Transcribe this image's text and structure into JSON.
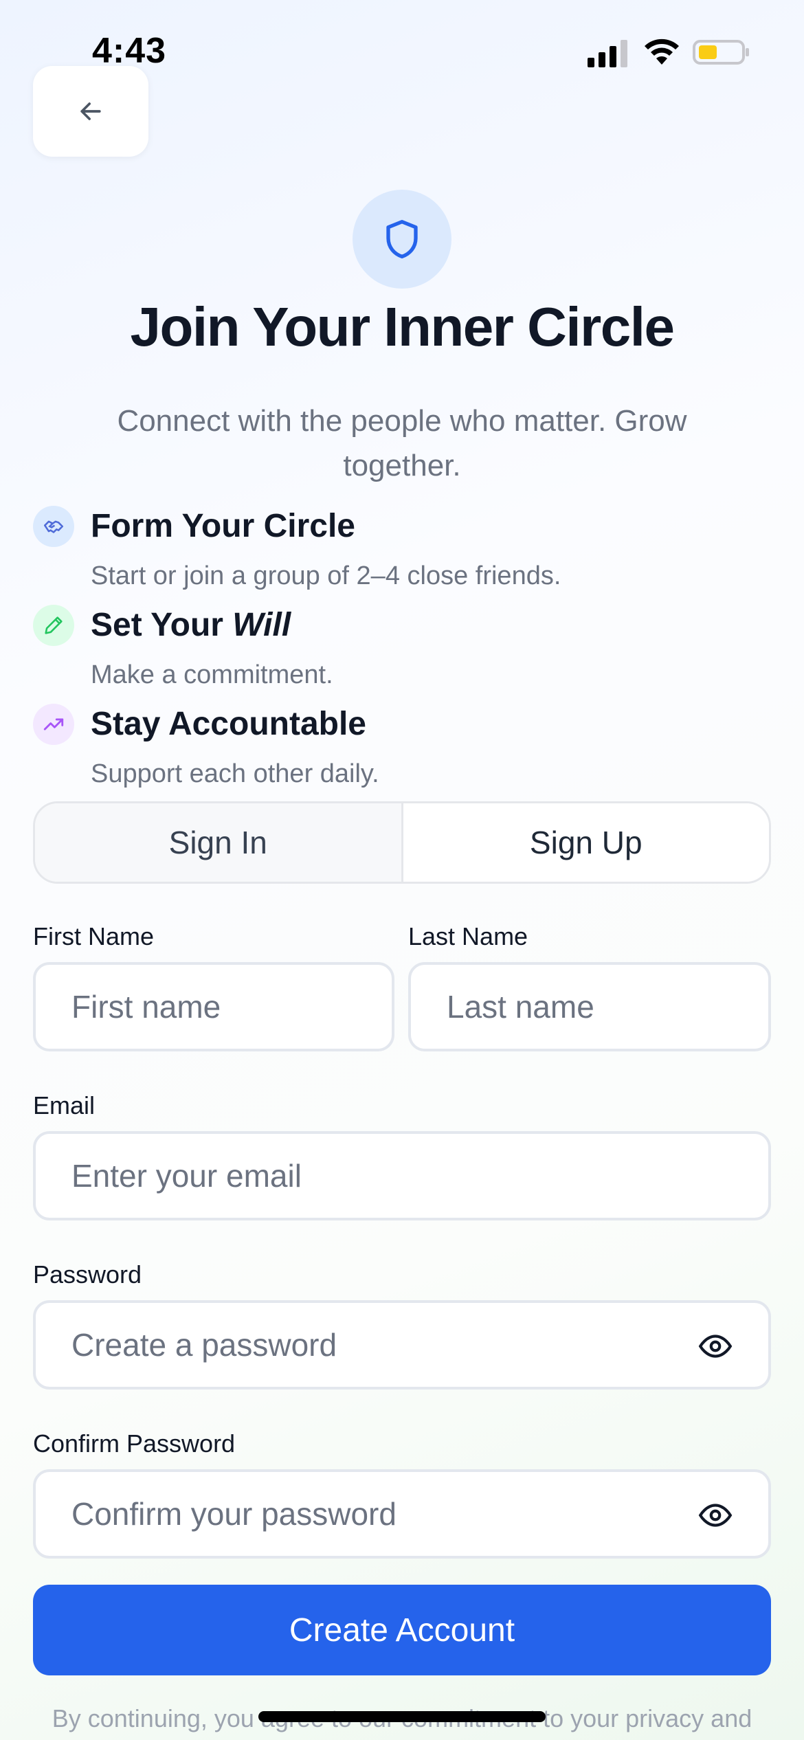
{
  "status_bar": {
    "time": "4:43",
    "battery_color": "#facc15"
  },
  "header": {
    "back_icon": "arrow-left-icon",
    "shield_icon": "shield-icon"
  },
  "hero": {
    "title": "Join Your Inner Circle",
    "subtitle": "Connect with the people who matter. Grow together."
  },
  "features": [
    {
      "icon": "handshake-icon",
      "title": "Form Your Circle",
      "description": "Start or join a group of 2–4 close friends.",
      "accent": "#4f6bd8"
    },
    {
      "icon": "pencil-icon",
      "title_prefix": "Set Your ",
      "title_emphasis": "Will",
      "description": "Make a commitment.",
      "accent": "#22c55e"
    },
    {
      "icon": "trending-up-icon",
      "title": "Stay Accountable",
      "description": "Support each other daily.",
      "accent": "#a855f7"
    }
  ],
  "tabs": {
    "sign_in": "Sign In",
    "sign_up": "Sign Up",
    "active": "Sign Up"
  },
  "form": {
    "first_name_label": "First Name",
    "first_name_placeholder": "First name",
    "last_name_label": "Last Name",
    "last_name_placeholder": "Last name",
    "email_label": "Email",
    "email_placeholder": "Enter your email",
    "password_label": "Password",
    "password_placeholder": "Create a password",
    "confirm_label": "Confirm Password",
    "confirm_placeholder": "Confirm your password",
    "eye_icon": "eye-icon"
  },
  "actions": {
    "create_account": "Create Account",
    "primary_color": "#2563eb"
  },
  "footer": {
    "text": "By continuing, you agree to our commitment to your privacy and"
  }
}
